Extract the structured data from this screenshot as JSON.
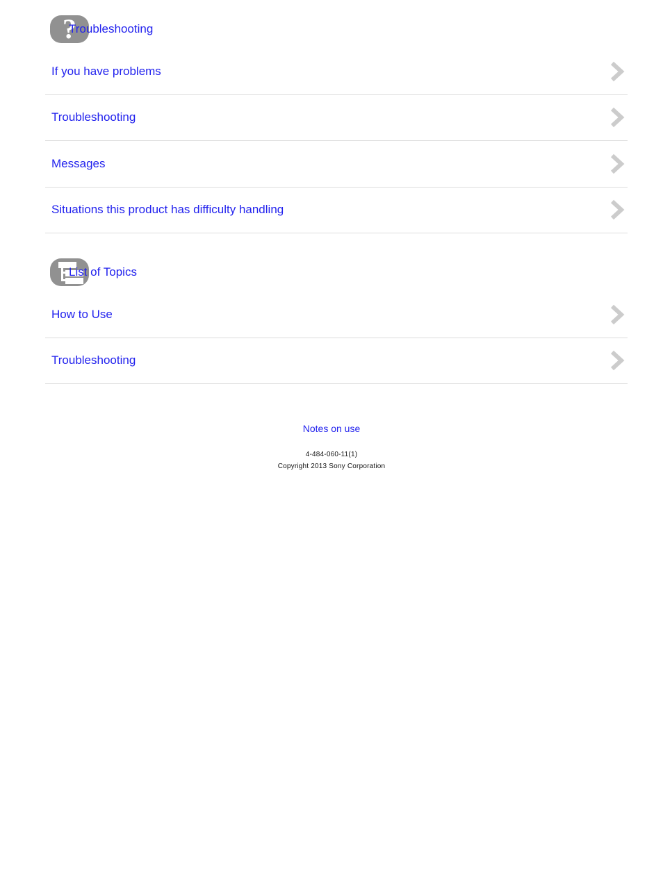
{
  "document": {
    "title": "Troubleshooting"
  },
  "sections": [
    {
      "icon": "question-mark-badge-icon",
      "title": "Troubleshooting",
      "items": [
        {
          "label": "If you have problems",
          "chevron": "chevron-right-icon"
        },
        {
          "label": "Troubleshooting",
          "chevron": "chevron-right-icon"
        },
        {
          "label": "Messages",
          "chevron": "chevron-right-icon"
        },
        {
          "label": "Situations this product has difficulty handling",
          "chevron": "chevron-right-icon"
        }
      ]
    },
    {
      "icon": "topic-tree-badge-icon",
      "title": "List of Topics",
      "items": [
        {
          "label": "How to Use",
          "chevron": "chevron-right-icon"
        },
        {
          "label": "Troubleshooting",
          "chevron": "chevron-right-icon"
        }
      ]
    }
  ],
  "footer": {
    "notes_link": "Notes on use",
    "model_no": "4-484-060-11(1)",
    "copyright": "Copyright 2013 Sony Corporation"
  },
  "colors": {
    "link": "#2222ee",
    "badge": "#919191",
    "chevron": "#cccccc",
    "divider": "#dcdcdc",
    "background": "#ffffff",
    "text": "#111111"
  }
}
